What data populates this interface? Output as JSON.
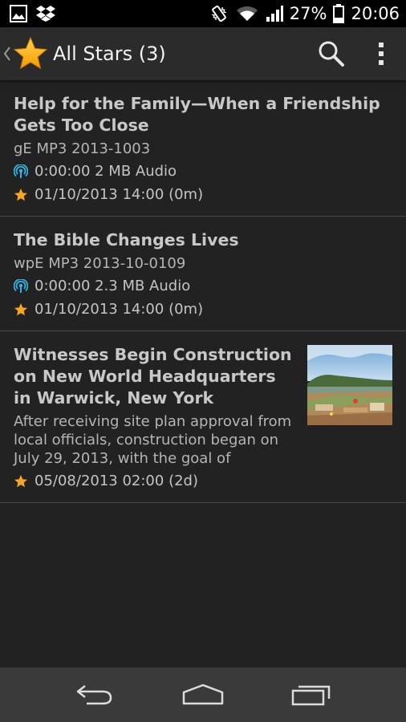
{
  "status_bar": {
    "battery": "27%",
    "time": "20:06",
    "icons": [
      "gallery-icon",
      "dropbox-icon",
      "vibrate-icon",
      "wifi-icon",
      "signal-icon",
      "battery-icon"
    ]
  },
  "action_bar": {
    "title": "All Stars (3)",
    "icons": [
      "back-caret-icon",
      "star-icon",
      "search-icon",
      "overflow-menu-icon"
    ]
  },
  "items": [
    {
      "title": "Help for the Family—When a Friendship Gets Too Close",
      "subtitle": "gE MP3 2013-1003",
      "media": "0:00:00 2 MB Audio",
      "date": "01/10/2013 14:00 (0m)"
    },
    {
      "title": "The Bible Changes Lives",
      "subtitle": "wpE MP3 2013-10-0109",
      "media": "0:00:00 2.3 MB Audio",
      "date": "01/10/2013 14:00 (0m)"
    },
    {
      "title": "Witnesses Begin Construction on New World Headquarters in Warwick, New York",
      "description": "After receiving site plan approval from local officials, construction began on July 29, 2013, with the goal of",
      "date": "05/08/2013 02:00 (2d)"
    }
  ],
  "nav_bar": {
    "icons": [
      "back-icon",
      "home-icon",
      "recents-icon"
    ]
  },
  "colors": {
    "accent_star": "#f5a623",
    "podcast_icon": "#33b5e5",
    "background": "#222222",
    "action_bar": "#2b2b2b",
    "nav_bar": "#3a3a3a"
  }
}
